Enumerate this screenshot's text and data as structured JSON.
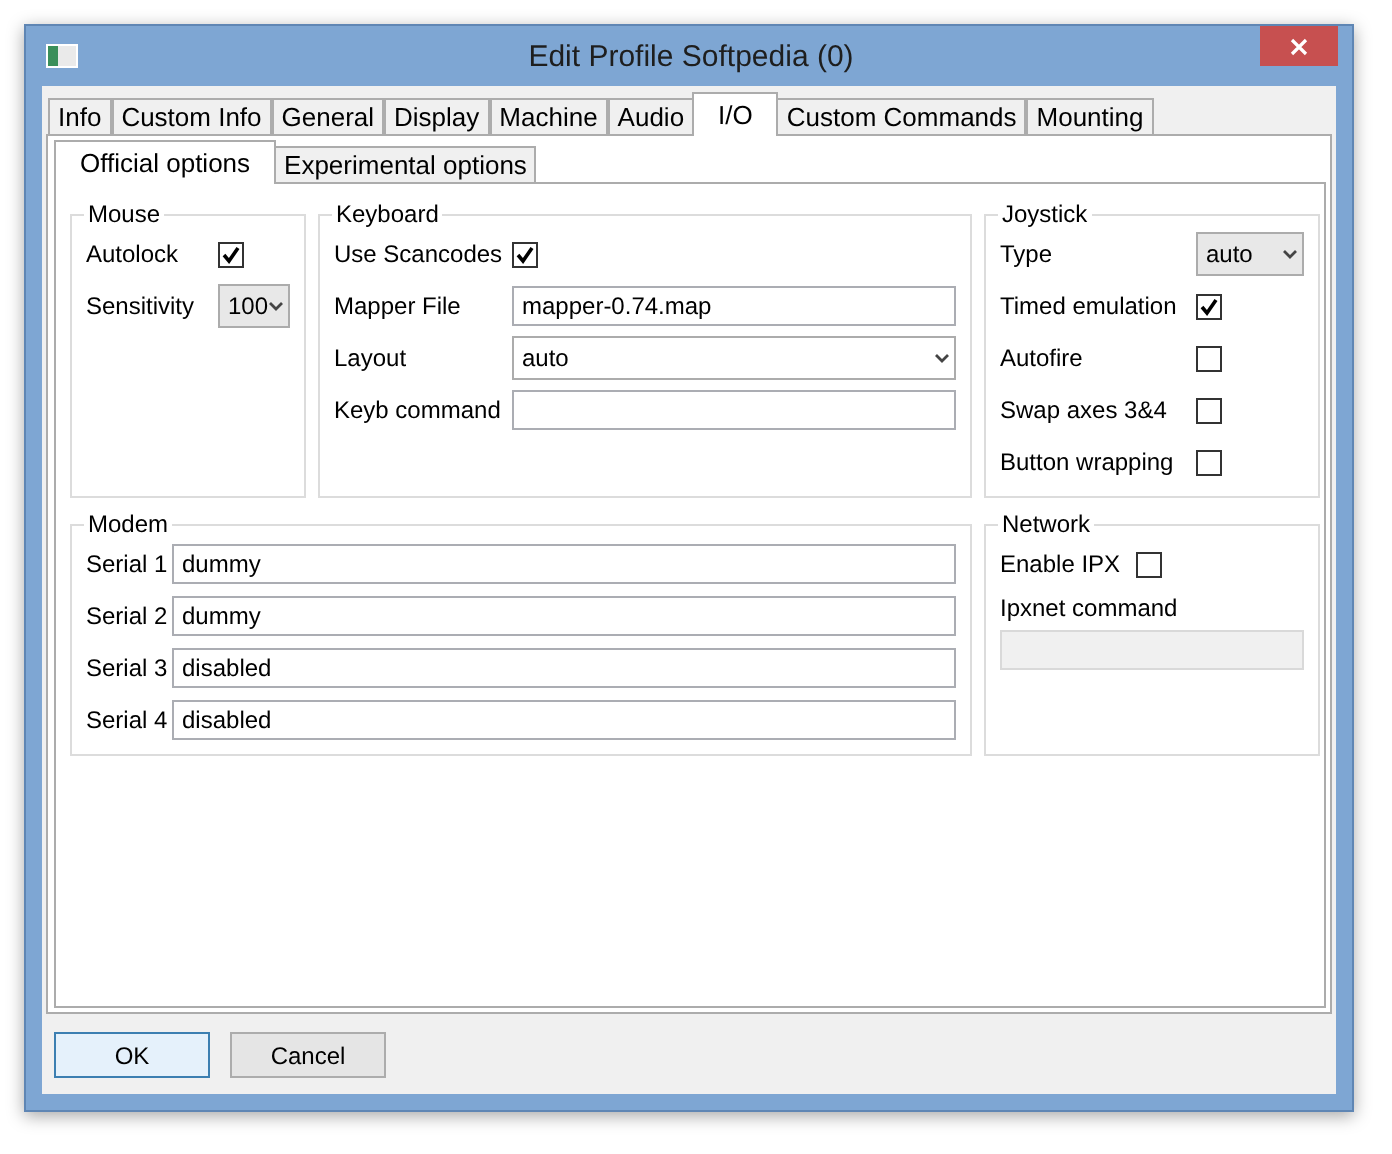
{
  "window": {
    "title": "Edit Profile Softpedia (0)"
  },
  "tabs": [
    {
      "label": "Info",
      "selected": false
    },
    {
      "label": "Custom Info",
      "selected": false
    },
    {
      "label": "General",
      "selected": false
    },
    {
      "label": "Display",
      "selected": false
    },
    {
      "label": "Machine",
      "selected": false
    },
    {
      "label": "Audio",
      "selected": false
    },
    {
      "label": "I/O",
      "selected": true
    },
    {
      "label": "Custom Commands",
      "selected": false
    },
    {
      "label": "Mounting",
      "selected": false
    }
  ],
  "subtabs": [
    {
      "label": "Official options",
      "selected": true
    },
    {
      "label": "Experimental options",
      "selected": false
    }
  ],
  "mouse": {
    "title": "Mouse",
    "rows": [
      {
        "kind": "checkbox",
        "label": "Autolock",
        "checked": true
      },
      {
        "kind": "select",
        "label": "Sensitivity",
        "value": "100"
      }
    ]
  },
  "keyboard": {
    "title": "Keyboard",
    "rows": [
      {
        "kind": "checkbox",
        "label": "Use Scancodes",
        "checked": true
      },
      {
        "kind": "text",
        "label": "Mapper File",
        "value": "mapper-0.74.map"
      },
      {
        "kind": "select",
        "label": "Layout",
        "value": "auto"
      },
      {
        "kind": "text",
        "label": "Keyb command"
      }
    ]
  },
  "joystick": {
    "title": "Joystick",
    "rows": [
      {
        "kind": "select",
        "label": "Type",
        "value": "auto"
      },
      {
        "kind": "checkbox",
        "label": "Timed emulation",
        "checked": true
      },
      {
        "kind": "checkbox",
        "label": "Autofire",
        "checked": false
      },
      {
        "kind": "checkbox",
        "label": "Swap axes 3&4",
        "checked": false
      },
      {
        "kind": "checkbox",
        "label": "Button wrapping",
        "checked": false
      }
    ]
  },
  "modem": {
    "title": "Modem",
    "rows": [
      {
        "label": "Serial 1",
        "value": "dummy"
      },
      {
        "label": "Serial 2",
        "value": "dummy"
      },
      {
        "label": "Serial 3",
        "value": "disabled"
      },
      {
        "label": "Serial 4",
        "value": "disabled"
      }
    ]
  },
  "network": {
    "title": "Network",
    "enable_ipx": {
      "label": "Enable IPX",
      "checked": false
    },
    "ipxnet": {
      "label": "Ipxnet command",
      "disabled": true
    }
  },
  "buttons": [
    {
      "label": "OK",
      "default": true
    },
    {
      "label": "Cancel",
      "default": false
    }
  ]
}
